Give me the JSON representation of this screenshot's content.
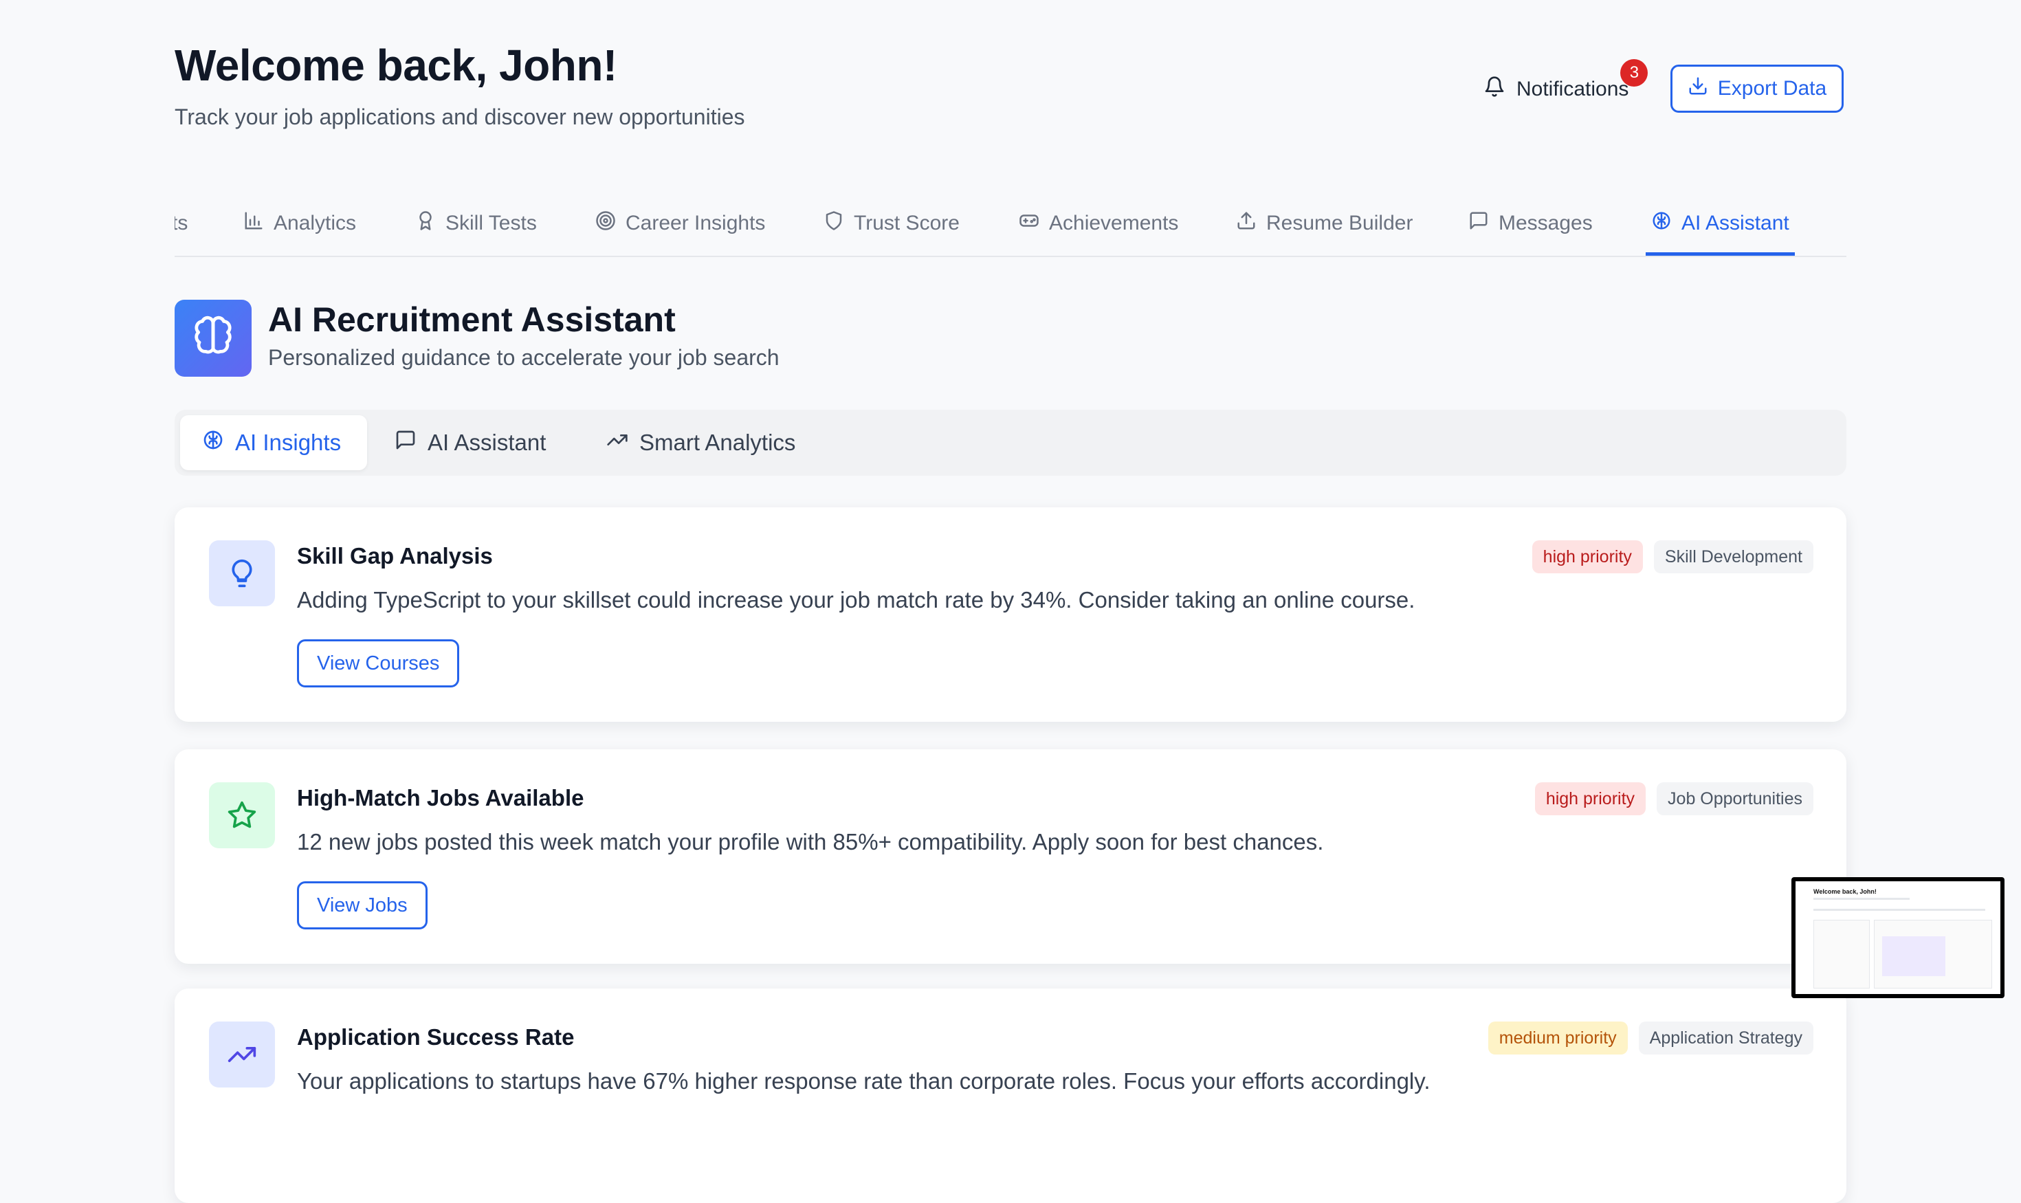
{
  "header": {
    "welcome": "Welcome back, John!",
    "subtitle": "Track your job applications and discover new opportunities",
    "notifications_label": "Notifications",
    "notifications_count": "3",
    "export_label": "Export Data"
  },
  "tabs": [
    {
      "label": "ts",
      "icon": "truncated",
      "active": false
    },
    {
      "label": "Analytics",
      "icon": "bar-chart-icon",
      "active": false
    },
    {
      "label": "Skill Tests",
      "icon": "award-icon",
      "active": false
    },
    {
      "label": "Career Insights",
      "icon": "target-icon",
      "active": false
    },
    {
      "label": "Trust Score",
      "icon": "shield-icon",
      "active": false
    },
    {
      "label": "Achievements",
      "icon": "gamepad-icon",
      "active": false
    },
    {
      "label": "Resume Builder",
      "icon": "upload-icon",
      "active": false
    },
    {
      "label": "Messages",
      "icon": "message-icon",
      "active": false
    },
    {
      "label": "AI Assistant",
      "icon": "brain-icon",
      "active": true
    }
  ],
  "section": {
    "title": "AI Recruitment Assistant",
    "subtitle": "Personalized guidance to accelerate your job search"
  },
  "subtabs": [
    {
      "label": "AI Insights",
      "icon": "brain-icon",
      "active": true
    },
    {
      "label": "AI Assistant",
      "icon": "message-icon",
      "active": false
    },
    {
      "label": "Smart Analytics",
      "icon": "trending-up-icon",
      "active": false
    }
  ],
  "insights": [
    {
      "title": "Skill Gap Analysis",
      "description": "Adding TypeScript to your skillset could increase your job match rate by 34%. Consider taking an online course.",
      "priority": "high priority",
      "category": "Skill Development",
      "action": "View Courses",
      "icon": "lightbulb-icon",
      "icon_bg": "#e0e7ff",
      "icon_color": "#2563eb"
    },
    {
      "title": "High-Match Jobs Available",
      "description": "12 new jobs posted this week match your profile with 85%+ compatibility. Apply soon for best chances.",
      "priority": "high priority",
      "category": "Job Opportunities",
      "action": "View Jobs",
      "icon": "star-icon",
      "icon_bg": "#dcfce7",
      "icon_color": "#16a34a"
    },
    {
      "title": "Application Success Rate",
      "description": "Your applications to startups have 67% higher response rate than corporate roles. Focus your efforts accordingly.",
      "priority": "medium priority",
      "category": "Application Strategy",
      "icon": "trending-up-icon",
      "icon_bg": "#e0e7ff",
      "icon_color": "#4f46e5"
    }
  ],
  "thumbnail": {
    "title": "Welcome back, John!"
  },
  "colors": {
    "accent": "#2563eb",
    "high_priority": "#b91c1c",
    "medium_priority": "#b45309"
  }
}
